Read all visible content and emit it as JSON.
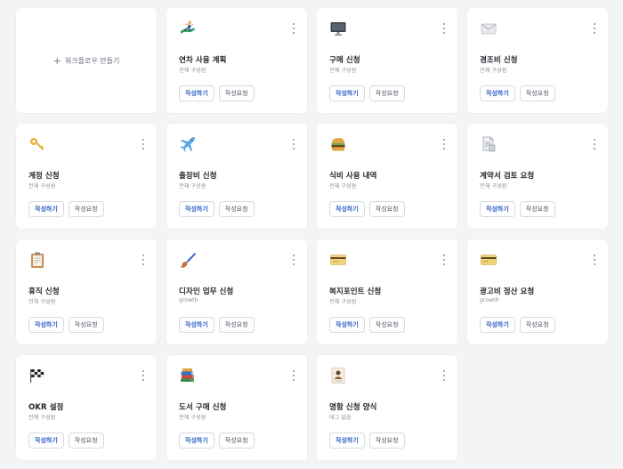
{
  "create_card": {
    "label": "워크플로우 만들기",
    "icon": "plus-icon"
  },
  "button_labels": {
    "primary": "작성하기",
    "secondary": "작성요청"
  },
  "cards": [
    {
      "title": "연차 사용 계획",
      "subtitle": "전체 구성원",
      "icon": "surfer-icon"
    },
    {
      "title": "구매 신청",
      "subtitle": "전체 구성원",
      "icon": "monitor-icon"
    },
    {
      "title": "경조비 신청",
      "subtitle": "전체 구성원",
      "icon": "envelope-icon"
    },
    {
      "title": "계정 신청",
      "subtitle": "전체 구성원",
      "icon": "key-icon"
    },
    {
      "title": "출장비 신청",
      "subtitle": "전체 구성원",
      "icon": "airplane-icon"
    },
    {
      "title": "식비 사용 내역",
      "subtitle": "전체 구성원",
      "icon": "burger-icon"
    },
    {
      "title": "계약서 검토 요청",
      "subtitle": "전체 구성원",
      "icon": "document-icon"
    },
    {
      "title": "휴직 신청",
      "subtitle": "전체 구성원",
      "icon": "clipboard-icon"
    },
    {
      "title": "디자인 업무 신청",
      "subtitle": "growth",
      "icon": "paintbrush-icon"
    },
    {
      "title": "복지포인트 신청",
      "subtitle": "전체 구성원",
      "icon": "credit-card-icon"
    },
    {
      "title": "광고비 정산 요청",
      "subtitle": "growth",
      "icon": "credit-card-icon"
    },
    {
      "title": "OKR 설정",
      "subtitle": "전체 구성원",
      "icon": "checkered-flag-icon"
    },
    {
      "title": "도서 구매 신청",
      "subtitle": "전체 구성원",
      "icon": "books-icon"
    },
    {
      "title": "명함 신청 양식",
      "subtitle": "태그 없음",
      "icon": "business-card-icon"
    }
  ],
  "colors": {
    "page_bg": "#f3f4f6",
    "card_bg": "#ffffff",
    "accent": "#2f5fc4",
    "muted": "#8a8f98"
  }
}
